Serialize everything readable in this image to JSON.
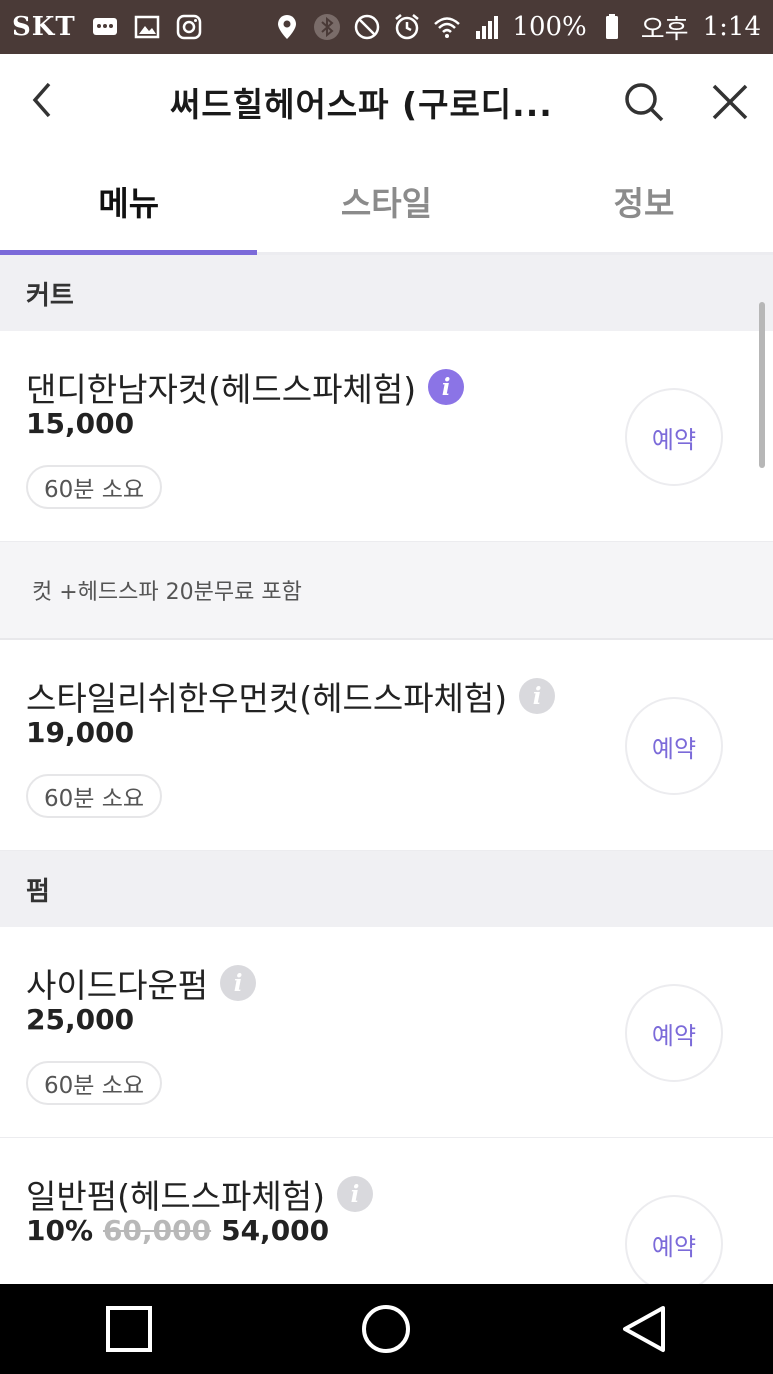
{
  "status_bar": {
    "carrier": "SKT",
    "battery": "100%",
    "ampm": "오후",
    "time": "1:14"
  },
  "header": {
    "title": "써드힐헤어스파 (구로디..."
  },
  "tabs": [
    {
      "label": "메뉴",
      "active": true
    },
    {
      "label": "스타일",
      "active": false
    },
    {
      "label": "정보",
      "active": false
    }
  ],
  "sections": [
    {
      "title": "커트",
      "items": [
        {
          "name": "댄디한남자컷(헤드스파체험)",
          "price": "15,000",
          "duration": "60분 소요",
          "reserve": "예약",
          "info_color": "purple",
          "note": "컷 +헤드스파 20분무료 포함"
        },
        {
          "name": "스타일리쉬한우먼컷(헤드스파체험)",
          "price": "19,000",
          "duration": "60분 소요",
          "reserve": "예약",
          "info_color": "gray"
        }
      ]
    },
    {
      "title": "펌",
      "items": [
        {
          "name": "사이드다운펌",
          "price": "25,000",
          "duration": "60분 소요",
          "reserve": "예약",
          "info_color": "gray"
        },
        {
          "name": "일반펌(헤드스파체험)",
          "discount": "10%",
          "original_price": "60,000",
          "price": "54,000",
          "reserve": "예약",
          "info_color": "gray"
        }
      ]
    }
  ],
  "colors": {
    "accent": "#7b6ad9",
    "status_bar": "#4a3a37",
    "section_bg": "#f0f0f3"
  }
}
